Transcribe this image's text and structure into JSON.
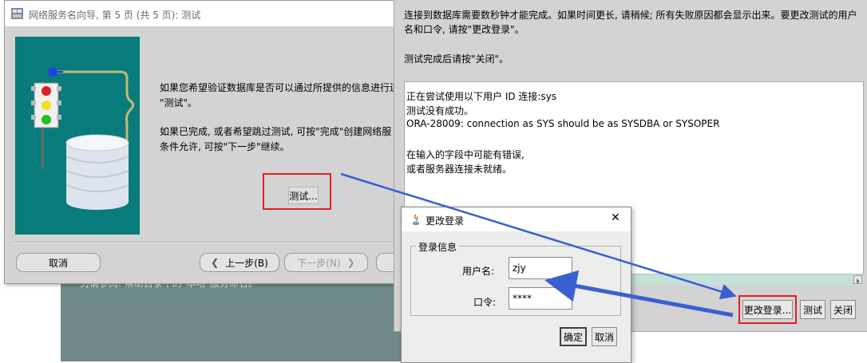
{
  "background": {
    "text": "另请参阅: 帮助目录中的\"本地\"服务命名。"
  },
  "wizard": {
    "title": "网络服务名向导, 第 5 页 (共 5 页): 测试",
    "para1_line1": "如果您希望验证数据库是否可以通过所提供的信息进行连",
    "para1_line2": "\"测试\"。",
    "para2_line1": "如果已完成, 或者希望跳过测试, 可按\"完成\"创建网络服",
    "para2_line2": "条件允许, 可按\"下一步\"继续。",
    "test_button": "测试...",
    "cancel_button": "取消",
    "back_button": "上一步(B)",
    "next_button": "下一步(N)"
  },
  "test_dialog": {
    "info_line1": "连接到数据库需要数秒钟才能完成。如果时间更长, 请稍候; 所有失败原因都会显示出来。要更改测试的用户",
    "info_line2": "名和口令, 请按\"更改登录\"。",
    "info_line3": "测试完成后请按\"关闭\"。",
    "results": [
      "正在尝试使用以下用户 ID 连接:sys",
      "测试没有成功。",
      "ORA-28009: connection as SYS should be as SYSDBA or SYSOPER",
      "",
      "在输入的字段中可能有错误,",
      "或者服务器连接未就绪。"
    ],
    "change_login_button": "更改登录...",
    "test_button": "测试",
    "close_button": "关闭"
  },
  "login_dialog": {
    "title": "更改登录",
    "group_label": "登录信息",
    "username_label": "用户名:",
    "username_value": "zjy",
    "password_label": "口令:",
    "password_value": "****",
    "ok_button": "确定",
    "cancel_button": "取消"
  },
  "colors": {
    "annotation_red": "#e02020",
    "annotation_arrow_blue": "#3a5fd0",
    "illustration_teal": "#087b7b"
  }
}
